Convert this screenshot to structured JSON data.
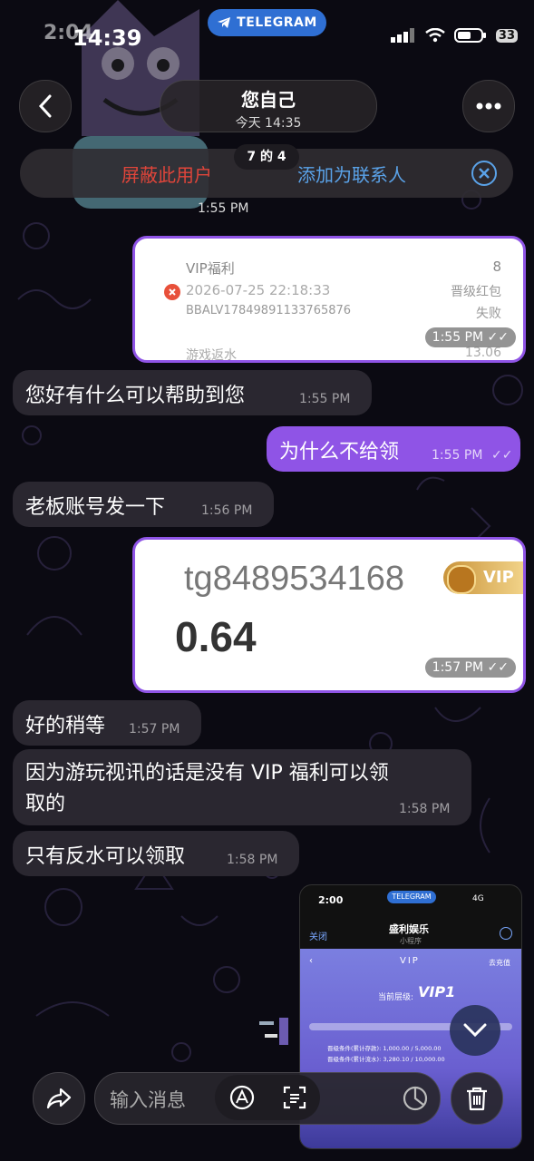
{
  "status_bar": {
    "time": "14:39",
    "time_ghost": "2:04",
    "badge": "33"
  },
  "telegram_pill": {
    "label": "TELEGRAM"
  },
  "header": {
    "title": "您自己",
    "subtitle": "今天 14:35"
  },
  "action_bar": {
    "block": "屏蔽此用户",
    "add_contact": "添加为联系人",
    "page_counter": "7 的 4"
  },
  "top_time": "1:55 PM",
  "record_card": {
    "title": "VIP福利",
    "datetime": "2026-07-25 22:18:33",
    "order_id": "BBALV17849891133765876",
    "amount": "8",
    "type": "晋级红包",
    "status": "失败",
    "next_title": "游戏返水",
    "next_amount": "13.06",
    "time": "1:55 PM"
  },
  "messages": [
    {
      "text": "您好有什么可以帮助到您",
      "time": "1:55 PM"
    },
    {
      "text": "为什么不给领",
      "time": "1:55 PM"
    },
    {
      "text": "老板账号发一下",
      "time": "1:56 PM"
    },
    {
      "text": "好的稍等",
      "time": "1:57 PM"
    },
    {
      "text": "因为游玩视讯的话是没有 VIP 福利可以领取的",
      "line1": "因为游玩视讯的话是没有 VIP 福利可以领",
      "line2": "取的",
      "time": "1:58 PM"
    },
    {
      "text": "只有反水可以领取",
      "time": "1:58 PM"
    }
  ],
  "account_card": {
    "account": "tg8489534168",
    "balance": "0.64",
    "vip_label": "VIP",
    "time": "1:57 PM"
  },
  "thumbnail": {
    "time": "2:00",
    "tg": "TELEGRAM",
    "close": "关闭",
    "app_title": "盛利娱乐",
    "app_sub": "小程序",
    "vip_header": "VIP",
    "recharge": "去充值",
    "current_level": "当前层级:",
    "level": "VIP1",
    "row1": "晋级条件(累计存款): 1,000.00 / 5,000.00",
    "row2": "晋级条件(累计流水): 3,280.10 / 10,000.00",
    "signal": "4G"
  },
  "composer": {
    "placeholder": "输入消息"
  }
}
